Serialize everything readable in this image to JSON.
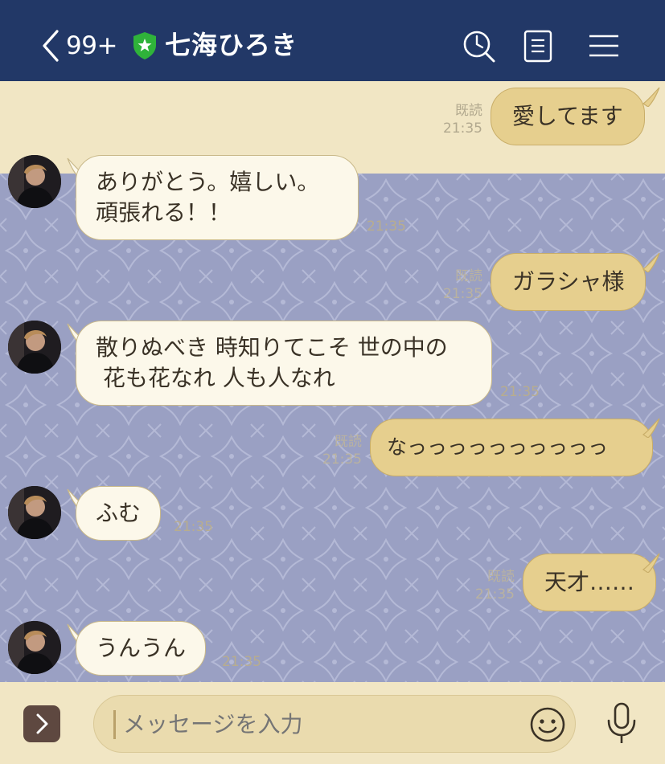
{
  "header": {
    "back_count": "99+",
    "title": "七海ひろき"
  },
  "messages": [
    {
      "dir": "out",
      "text": "愛してます",
      "read": "既読",
      "time": "21:35"
    },
    {
      "dir": "in",
      "lines": [
        "ありがとう。嬉しい。",
        "頑張れる！！"
      ],
      "time": "21:35"
    },
    {
      "dir": "out",
      "text": "ガラシャ様",
      "read": "既読",
      "time": "21:35"
    },
    {
      "dir": "in",
      "lines": [
        "散りぬべき 時知りてこそ 世の中の",
        " 花も花なれ 人も人なれ"
      ],
      "time": "21:35"
    },
    {
      "dir": "out",
      "text": "なっっっっっっっっっっ",
      "read": "既読",
      "time": "21:35"
    },
    {
      "dir": "in",
      "lines": [
        "ふむ"
      ],
      "time": "21:35"
    },
    {
      "dir": "out",
      "text": "天才……",
      "read": "既読",
      "time": "21:35"
    },
    {
      "dir": "in",
      "lines": [
        "うんうん"
      ],
      "time": "21:35"
    }
  ],
  "footer": {
    "placeholder": "メッセージを入力"
  },
  "colors": {
    "header_bg": "#223867",
    "shield": "#2fb33a",
    "out_bubble": "#e6cf8e",
    "in_bubble": "#fcf8ea",
    "chat_bg_pattern": "#9aa0c3",
    "chat_bg_plain": "#f1e6c4"
  },
  "icons": [
    "chevron-left-icon",
    "shield-star-icon",
    "search-clock-icon",
    "notes-icon",
    "menu-icon",
    "chevron-right-icon",
    "smiley-icon",
    "microphone-icon"
  ]
}
